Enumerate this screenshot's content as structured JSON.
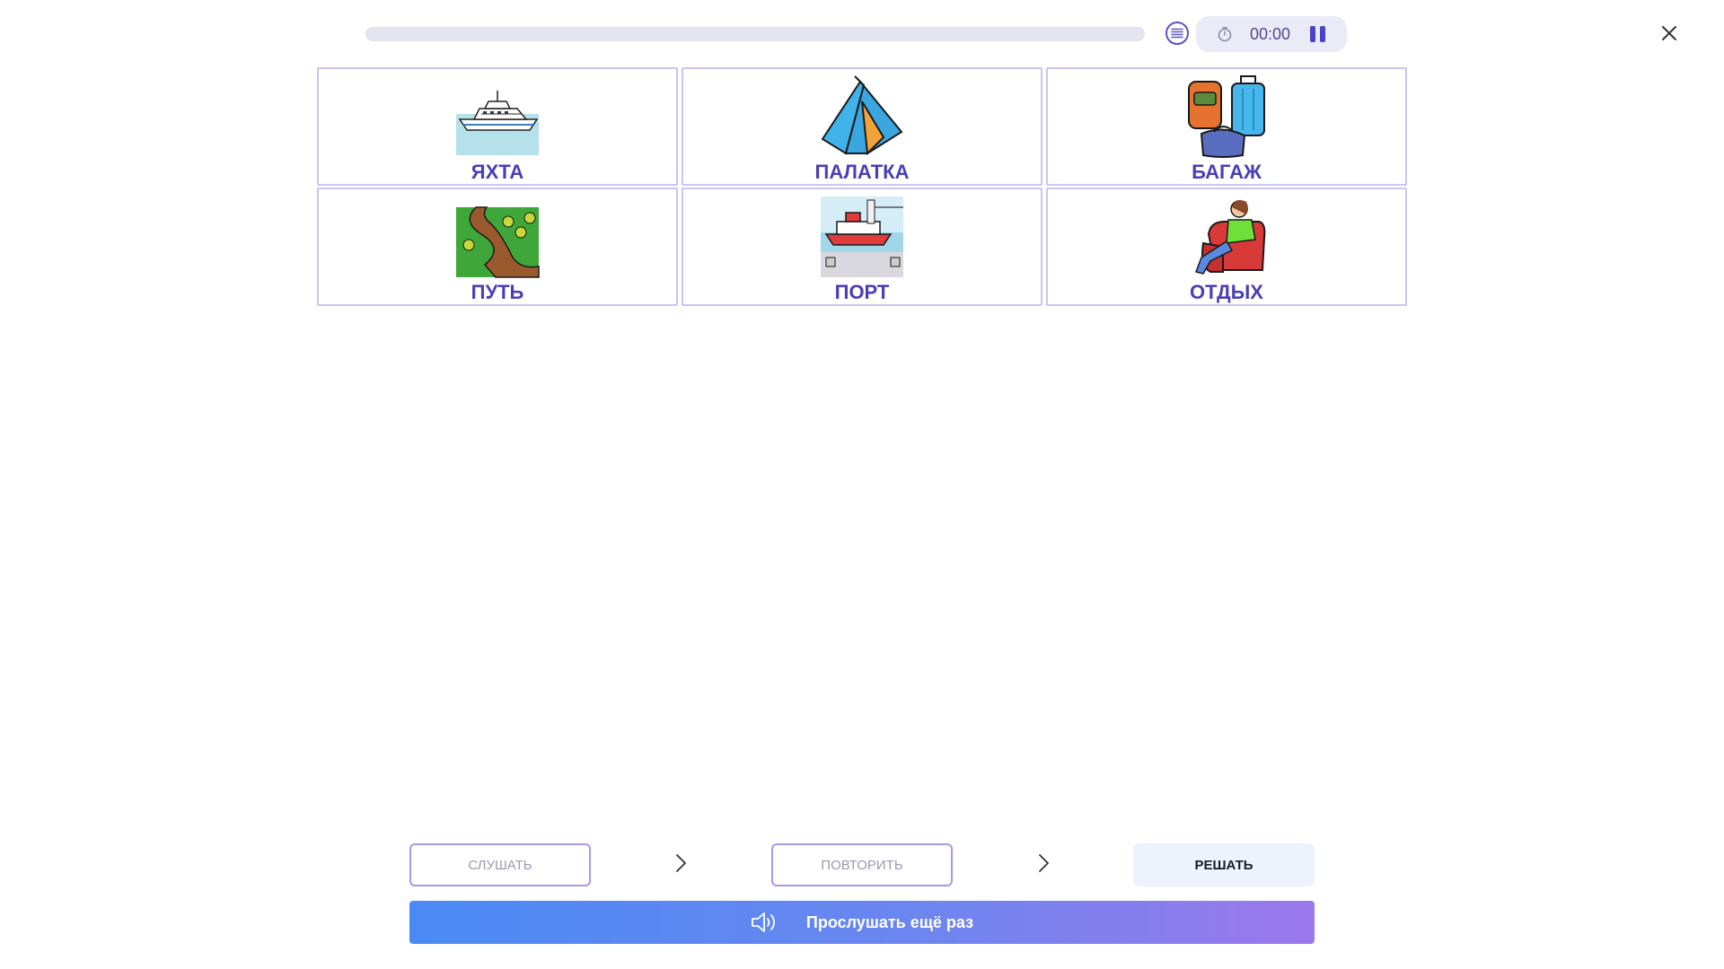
{
  "header": {
    "progress": 0,
    "timer": "00:00",
    "icons": {
      "list": "list-icon",
      "clock": "clock-icon",
      "pause": "pause-icon",
      "close": "close-icon"
    }
  },
  "cards": [
    {
      "word": "ЯХТА",
      "icon": "yacht-icon"
    },
    {
      "word": "ПАЛАТКА",
      "icon": "tent-icon"
    },
    {
      "word": "БАГАЖ",
      "icon": "luggage-icon"
    },
    {
      "word": "ПУТЬ",
      "icon": "path-icon"
    },
    {
      "word": "ПОРТ",
      "icon": "port-icon"
    },
    {
      "word": "ОТДЫХ",
      "icon": "rest-icon"
    }
  ],
  "steps": {
    "listen": "СЛУШАТЬ",
    "repeat": "ПОВТОРИТЬ",
    "solve": "РЕШАТЬ"
  },
  "listen_again": "Прослушать ещё раз",
  "colors": {
    "accent": "#4a3fb5",
    "card_border": "#c9c6f3",
    "gradient_start": "#4a8af4",
    "gradient_end": "#9b78ec"
  }
}
